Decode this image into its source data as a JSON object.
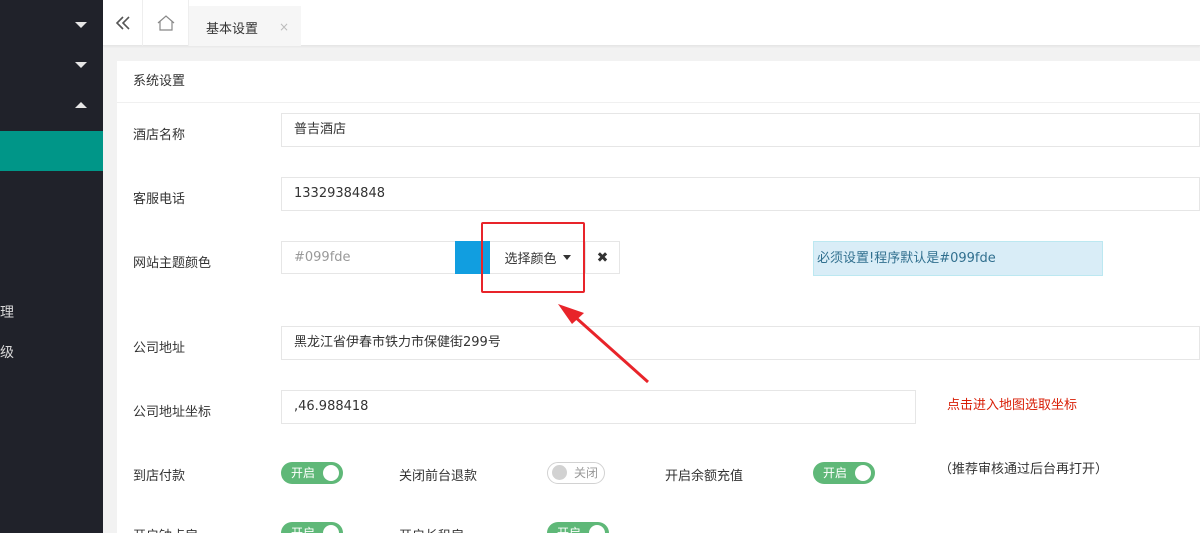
{
  "sidebar": {
    "partial_item_1": "理",
    "partial_item_2": "级"
  },
  "tabbar": {
    "collapse_icon": "double-chevron-left",
    "home_icon": "home",
    "active_tab": "基本设置",
    "close_glyph": "×"
  },
  "card": {
    "header": "系统设置"
  },
  "form": {
    "hotel_name_label": "酒店名称",
    "hotel_name_value": "普吉酒店",
    "phone_label": "客服电话",
    "phone_value": "13329384848",
    "theme_color_label": "网站主题颜色",
    "theme_color_placeholder": "#099fde",
    "theme_swatch_color": "#119ee0",
    "pick_color_button": "选择颜色",
    "clear_color_glyph": "✖",
    "theme_hint": "必须设置!程序默认是#099fde",
    "address_label": "公司地址",
    "address_value": "黑龙江省伊春市铁力市保健街299号",
    "coords_label": "公司地址坐标",
    "coords_value": ",46.988418",
    "map_link": "点击进入地图选取坐标",
    "pay_at_store_label": "到店付款",
    "pay_at_store_state": "开启",
    "close_refund_label": "关闭前台退款",
    "close_refund_state": "关闭",
    "balance_recharge_label": "开启余额充值",
    "balance_recharge_state": "开启",
    "recharge_note": "（推荐审核通过后台再打开）",
    "hourly_label": "开启钟点房",
    "hourly_state": "开启",
    "long_rent_label": "开启长租房",
    "long_rent_state": "开启"
  },
  "annotation": {
    "highlight_color": "#e8242a"
  }
}
